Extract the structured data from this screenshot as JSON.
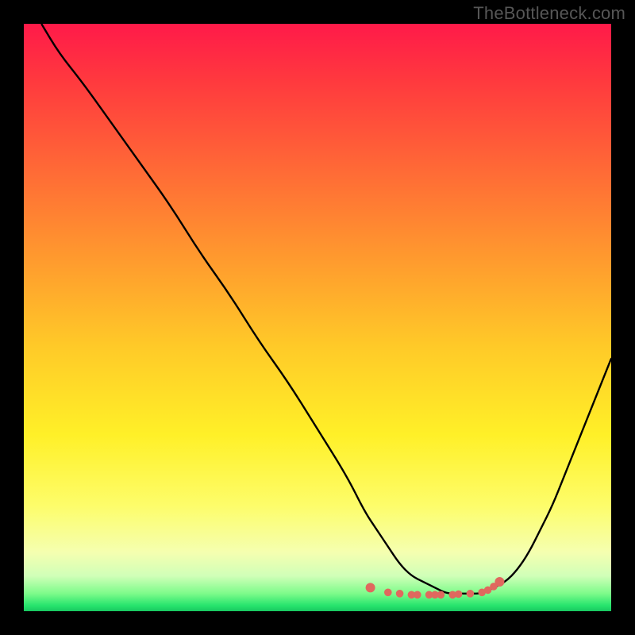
{
  "attribution": "TheBottleneck.com",
  "colors": {
    "frame": "#000000",
    "curve": "#000000",
    "dot": "#e0685e",
    "gradient_stops": [
      {
        "pos": 0,
        "color": "#ff1a49"
      },
      {
        "pos": 10,
        "color": "#ff3a3e"
      },
      {
        "pos": 25,
        "color": "#ff6a36"
      },
      {
        "pos": 40,
        "color": "#ff9a2e"
      },
      {
        "pos": 55,
        "color": "#ffca28"
      },
      {
        "pos": 70,
        "color": "#fff028"
      },
      {
        "pos": 82,
        "color": "#fdfd6a"
      },
      {
        "pos": 90,
        "color": "#f5ffb0"
      },
      {
        "pos": 94,
        "color": "#d0ffb8"
      },
      {
        "pos": 97,
        "color": "#7dfb8a"
      },
      {
        "pos": 99,
        "color": "#28e56e"
      },
      {
        "pos": 100,
        "color": "#18c860"
      }
    ],
    "attribution_color": "#565656"
  },
  "chart_data": {
    "type": "line",
    "title": "",
    "xlabel": "",
    "ylabel": "",
    "xlim": [
      0,
      100
    ],
    "ylim": [
      0,
      100
    ],
    "series": [
      {
        "name": "bottleneck-curve",
        "x": [
          3,
          6,
          10,
          15,
          20,
          25,
          30,
          35,
          40,
          45,
          50,
          55,
          58,
          60,
          62,
          64,
          66,
          68,
          70,
          72,
          74,
          76,
          78,
          80,
          82,
          84,
          86,
          88,
          90,
          92,
          94,
          96,
          98,
          100
        ],
        "y": [
          100,
          95,
          90,
          83,
          76,
          69,
          61,
          54,
          46,
          39,
          31,
          23,
          17,
          14,
          11,
          8,
          6,
          5,
          4,
          3,
          3,
          3,
          3,
          4,
          5,
          7,
          10,
          14,
          18,
          23,
          28,
          33,
          38,
          43
        ]
      },
      {
        "name": "valley-markers",
        "type": "scatter",
        "x": [
          59,
          62,
          64,
          66,
          67,
          69,
          70,
          71,
          73,
          74,
          76,
          78,
          79,
          80,
          81
        ],
        "y": [
          4.0,
          3.2,
          3.0,
          2.8,
          2.8,
          2.8,
          2.8,
          2.8,
          2.8,
          2.9,
          3.0,
          3.2,
          3.6,
          4.2,
          5.0
        ]
      }
    ],
    "notes": "No axes, ticks, or legend are visible. The background is a vertical red-to-green gradient indicating bottleneck severity (red=high, green=low). The black curve drops from upper-left to a flat minimum around x≈65–78, then rises toward the right edge. Coral dots mark the valley floor."
  }
}
